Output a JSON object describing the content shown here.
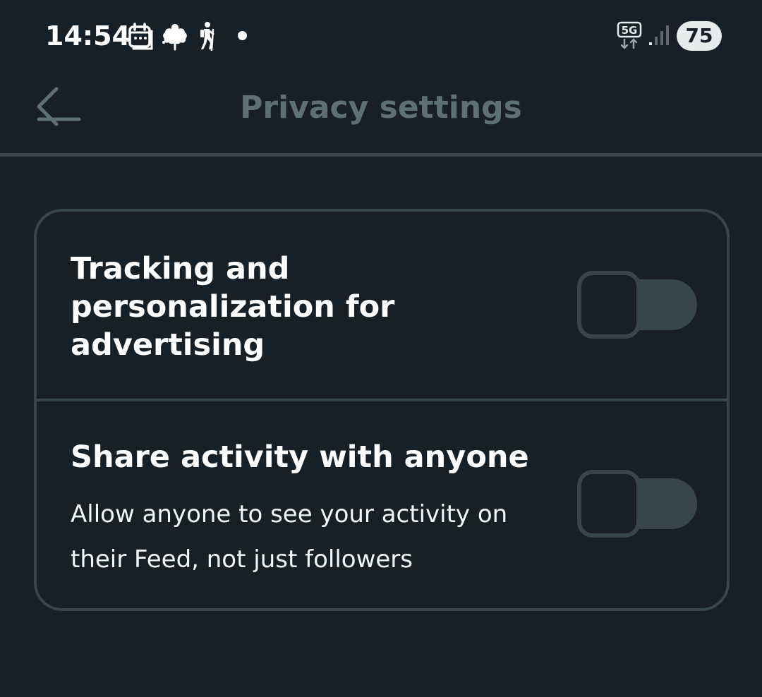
{
  "status_bar": {
    "time": "14:54",
    "notification_icons": [
      "calendar-icon",
      "leaf-icon",
      "hiker-icon",
      "dot-icon"
    ],
    "network_label": "5G",
    "battery": "75"
  },
  "app_bar": {
    "back_icon": "arrow-left-icon",
    "title": "Privacy settings"
  },
  "settings": [
    {
      "title": "Tracking and personalization for advertising",
      "description": "",
      "enabled": false
    },
    {
      "title": "Share activity with anyone",
      "description": "Allow anyone to see your activity on their Feed, not just followers",
      "enabled": false
    }
  ],
  "colors": {
    "background": "#162026",
    "border": "#37464d",
    "title_muted": "#5e7077",
    "text": "#ffffff"
  }
}
